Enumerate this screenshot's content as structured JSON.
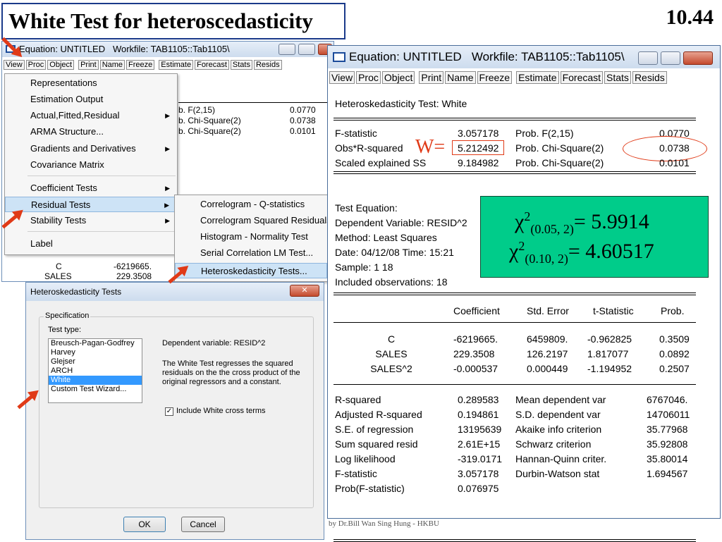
{
  "slide": {
    "title": "White Test for heteroscedasticity",
    "number": "10.44",
    "footer": "by Dr.Bill Wan Sing Hung - HKBU"
  },
  "back_window": {
    "title": "Equation: UNTITLED   Workfile: TAB1105::Tab1105\\",
    "toolbar": [
      "View",
      "Proc",
      "Object",
      "Print",
      "Name",
      "Freeze",
      "Estimate",
      "Forecast",
      "Stats",
      "Resids"
    ],
    "partial_rows": [
      {
        "label": "b. F(2,15)",
        "value": "0.0770"
      },
      {
        "label": "b. Chi-Square(2)",
        "value": "0.0738"
      },
      {
        "label": "b. Chi-Square(2)",
        "value": "0.0101"
      }
    ],
    "partial_coef": [
      {
        "name": "C",
        "value": "-6219665."
      },
      {
        "name": "SALES",
        "value": "229.3508"
      }
    ]
  },
  "view_menu": {
    "items": [
      {
        "label": "Representations",
        "submenu": false
      },
      {
        "label": "Estimation Output",
        "submenu": false
      },
      {
        "label": "Actual,Fitted,Residual",
        "submenu": true
      },
      {
        "label": "ARMA Structure...",
        "submenu": false
      },
      {
        "label": "Gradients and Derivatives",
        "submenu": true
      },
      {
        "label": "Covariance Matrix",
        "submenu": false
      },
      {
        "label": "Coefficient Tests",
        "submenu": true
      },
      {
        "label": "Residual Tests",
        "submenu": true,
        "selected": true
      },
      {
        "label": "Stability Tests",
        "submenu": true
      },
      {
        "label": "Label",
        "submenu": false
      }
    ]
  },
  "residual_menu": {
    "items": [
      {
        "label": "Correlogram - Q-statistics"
      },
      {
        "label": "Correlogram Squared Residuals"
      },
      {
        "label": "Histogram - Normality Test"
      },
      {
        "label": "Serial Correlation LM Test..."
      },
      {
        "label": "Heteroskedasticity Tests...",
        "selected": true
      }
    ]
  },
  "dialog": {
    "title": "Heteroskedasticity Tests",
    "group_label": "Specification",
    "test_type_label": "Test type:",
    "test_types": [
      "Breusch-Pagan-Godfrey",
      "Harvey",
      "Glejser",
      "ARCH",
      "White",
      "Custom Test Wizard..."
    ],
    "selected_test": "White",
    "dependent_variable": "Dependent variable: RESID^2",
    "description": "The White Test regresses the squared residuals on the the cross product of the original regressors and a constant.",
    "checkbox_label": "Include White cross terms",
    "checkbox_checked": true,
    "ok_label": "OK",
    "cancel_label": "Cancel"
  },
  "front_window": {
    "title": "Equation: UNTITLED   Workfile: TAB1105::Tab1105\\",
    "toolbar": [
      "View",
      "Proc",
      "Object",
      "Print",
      "Name",
      "Freeze",
      "Estimate",
      "Forecast",
      "Stats",
      "Resids"
    ],
    "heading": "Heteroskedasticity Test: White",
    "tests": [
      {
        "label": "F-statistic",
        "value": "3.057178",
        "prob_label": "Prob. F(2,15)",
        "prob": "0.0770"
      },
      {
        "label": "Obs*R-squared",
        "value": "5.212492",
        "prob_label": "Prob. Chi-Square(2)",
        "prob": "0.0738"
      },
      {
        "label": "Scaled explained SS",
        "value": "9.184982",
        "prob_label": "Prob. Chi-Square(2)",
        "prob": "0.0101"
      }
    ],
    "w_annotation": "W=",
    "test_equation": [
      "Test Equation:",
      "Dependent Variable: RESID^2",
      "Method: Least Squares",
      "Date: 04/12/08   Time: 15:21",
      "Sample: 1 18",
      "Included observations: 18"
    ],
    "coef_headers": [
      "Coefficient",
      "Std. Error",
      "t-Statistic",
      "Prob."
    ],
    "coef_rows": [
      {
        "var": "C",
        "coef": "-6219665.",
        "se": "6459809.",
        "t": "-0.962825",
        "p": "0.3509"
      },
      {
        "var": "SALES",
        "coef": "229.3508",
        "se": "126.2197",
        "t": "1.817077",
        "p": "0.0892"
      },
      {
        "var": "SALES^2",
        "coef": "-0.000537",
        "se": "0.000449",
        "t": "-1.194952",
        "p": "0.2507"
      }
    ],
    "stats_left": [
      {
        "label": "R-squared",
        "value": "0.289583"
      },
      {
        "label": "Adjusted R-squared",
        "value": "0.194861"
      },
      {
        "label": "S.E. of regression",
        "value": "13195639"
      },
      {
        "label": "Sum squared resid",
        "value": "2.61E+15"
      },
      {
        "label": "Log likelihood",
        "value": "-319.0171"
      },
      {
        "label": "F-statistic",
        "value": "3.057178"
      },
      {
        "label": "Prob(F-statistic)",
        "value": "0.076975"
      }
    ],
    "stats_right": [
      {
        "label": "Mean dependent var",
        "value": "6767046."
      },
      {
        "label": "S.D. dependent var",
        "value": "14706011"
      },
      {
        "label": "Akaike info criterion",
        "value": "35.77968"
      },
      {
        "label": "Schwarz criterion",
        "value": "35.92808"
      },
      {
        "label": "Hannan-Quinn criter.",
        "value": "35.80014"
      },
      {
        "label": "Durbin-Watson stat",
        "value": "1.694567"
      }
    ]
  },
  "chi_box": {
    "line1": {
      "chi": "χ",
      "sup": "2",
      "sub": "(0.05, 2)",
      "val": "= 5.9914"
    },
    "line2": {
      "chi": "χ",
      "sup": "2",
      "sub": "(0.10, 2)",
      "val": "= 4.60517"
    }
  },
  "colors": {
    "chi_box_bg": "#00cc8a",
    "annotation_red": "#e03a17",
    "selected_list": "#3399ff",
    "menu_highlight": "#cde3f6"
  }
}
